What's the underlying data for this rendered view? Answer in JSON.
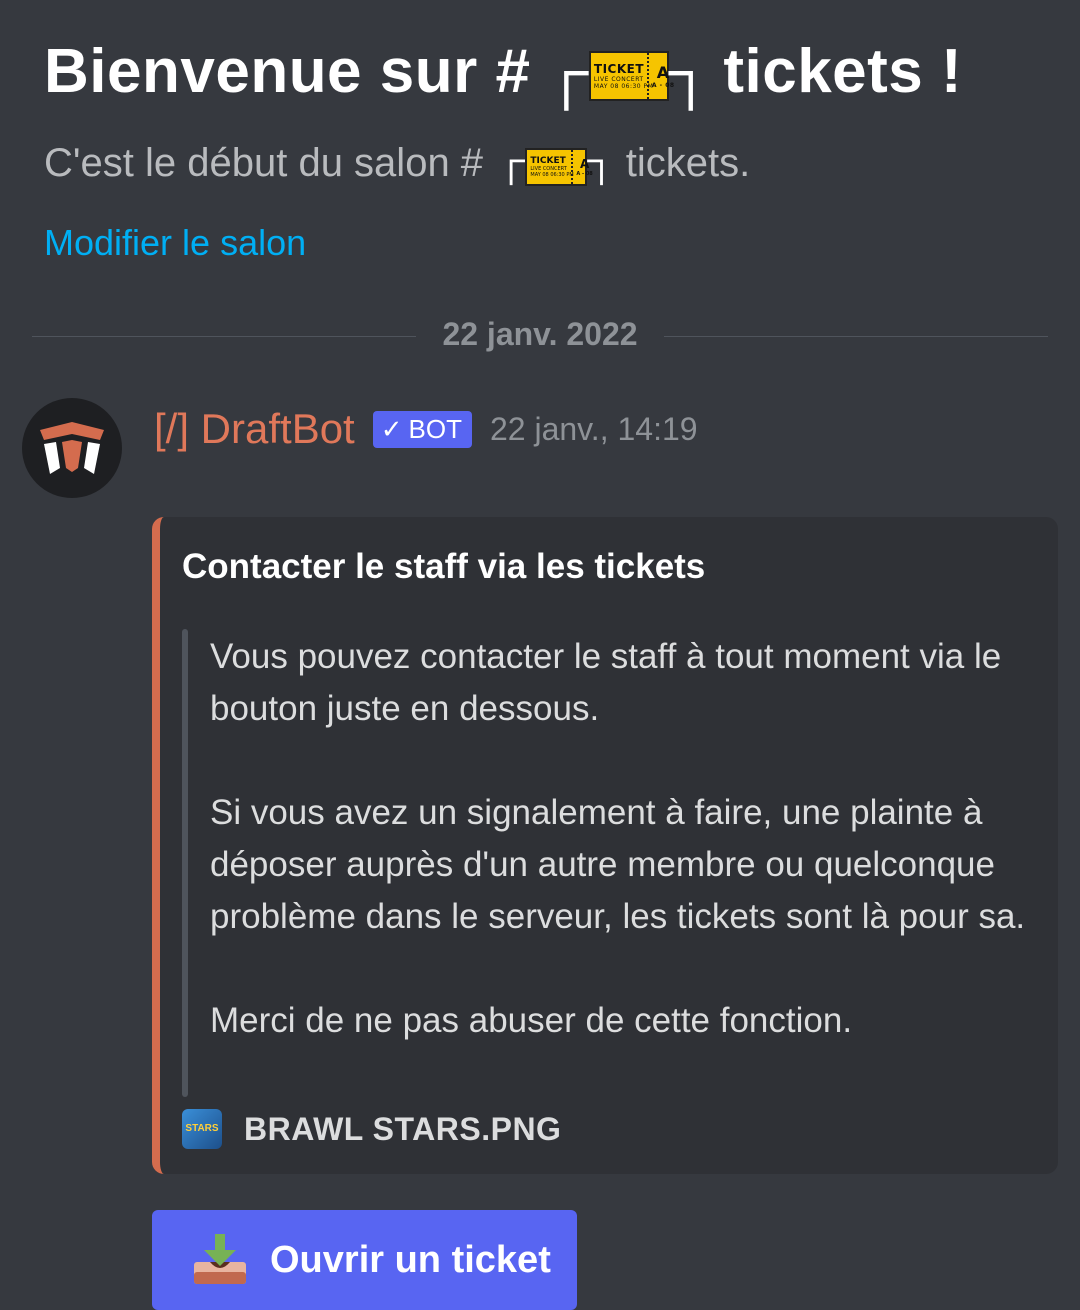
{
  "welcome": {
    "title_prefix": "Bienvenue sur #",
    "title_suffix": "tickets !",
    "subtitle_prefix": "C'est le début du salon #",
    "subtitle_suffix": "tickets.",
    "ticket_emoji": {
      "main": "TICKET",
      "sub": "LIVE CONCERT",
      "date": "MAY 08 06:30 PM",
      "seat": "A",
      "seat_code": "A - 08"
    },
    "edit_link": "Modifier le salon"
  },
  "divider": {
    "date": "22 janv. 2022"
  },
  "message": {
    "author": "[/] DraftBot",
    "bot_tag": "BOT",
    "timestamp": "22 janv., 14:19",
    "embed": {
      "accent_color": "#d46c4e",
      "title": "Contacter le staff via les tickets",
      "paragraphs": [
        "Vous pouvez contacter le staff à tout moment via le bouton juste en dessous.",
        "Si vous avez un signalement à faire, une plainte à déposer auprès d'un autre membre ou quelconque problème dans le serveur, les tickets sont là pour sa.",
        "Merci de ne pas abuser de cette fonction."
      ],
      "footer_icon_text": "STARS",
      "footer": "BRAWL STARS.PNG"
    },
    "button": {
      "label": "Ouvrir un ticket",
      "icon": "inbox-download-icon",
      "color": "#5865f2"
    }
  }
}
